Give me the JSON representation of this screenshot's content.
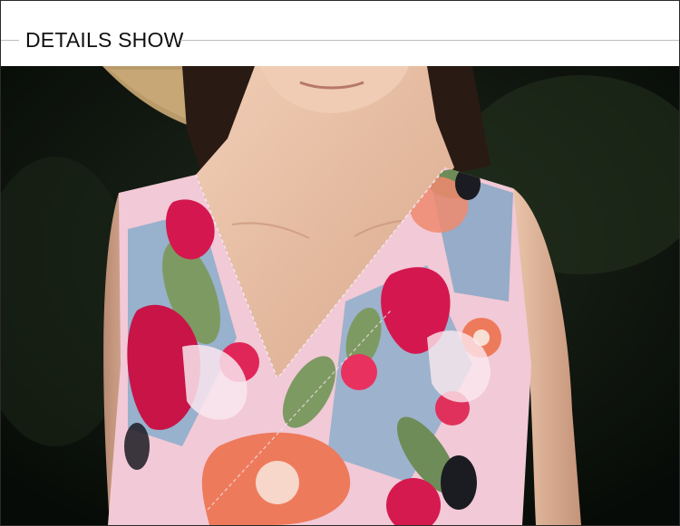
{
  "header": {
    "title": "DETAILS SHOW"
  },
  "photo": {
    "subject": "woman-floral-dress-closeup",
    "colors": {
      "background": "#0d140d",
      "skin": "#e8c2a8",
      "dress_base": "#f2c9d6",
      "magenta": "#d4184f",
      "coral": "#ee7a5c",
      "leaf": "#7d9a62",
      "blue": "#79a8c9",
      "hat": "#b99a6a"
    }
  }
}
